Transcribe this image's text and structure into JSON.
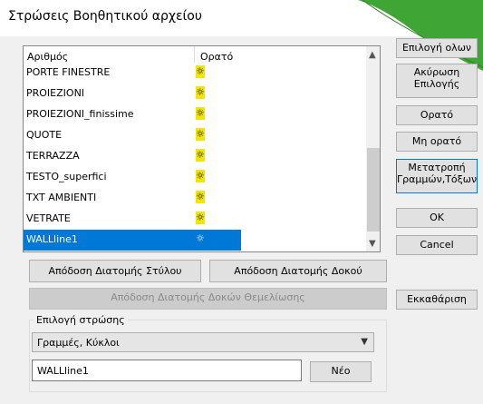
{
  "window": {
    "title": "Στρώσεις Βοηθητικού αρχείου",
    "close_glyph": "✕"
  },
  "list": {
    "col_number": "Αριθμός",
    "col_visible": "Ορατό",
    "rows": [
      {
        "name": "PORTE FINESTRE",
        "visible": "☼"
      },
      {
        "name": "PROIEZIONI",
        "visible": "☼"
      },
      {
        "name": "PROIEZIONI_finissime",
        "visible": "☼"
      },
      {
        "name": "QUOTE",
        "visible": "☼"
      },
      {
        "name": "TERRAZZA",
        "visible": "☼"
      },
      {
        "name": "TESTO_superfici",
        "visible": "☼"
      },
      {
        "name": "TXT AMBIENTI",
        "visible": "☼"
      },
      {
        "name": "VETRATE",
        "visible": "☼"
      },
      {
        "name": "WALLline1",
        "visible": "☼"
      }
    ],
    "selected_index": 8,
    "scroll_up": "▲",
    "scroll_down": "▼"
  },
  "side_buttons": {
    "select_all": "Επιλογή ολων",
    "cancel_selection_1": "Ακύρωση",
    "cancel_selection_2": "Επιλογής",
    "visible": "Ορατό",
    "invisible": "Μη ορατό",
    "convert_1": "Μετατροπή",
    "convert_2": "Γραμμών,Τόξων",
    "ok": "OK",
    "cancel": "Cancel"
  },
  "actions": {
    "assign_column": "Απόδοση Διατομής Στύλου",
    "assign_beam": "Απόδοση Διατομής Δοκού",
    "assign_foundation_beams": "Απόδοση Διατομής Δοκών Θεμελίωσης",
    "clear": "Εκκαθάριση"
  },
  "layer_select": {
    "label": "Επιλογή στρώσης",
    "combo_value": "Γραμμές, Κύκλοι",
    "combo_arrow": "▼",
    "input_value": "WALLline1",
    "new_button": "Νέο"
  },
  "colors": {
    "selection": "#0078d7",
    "accent_green": "#3fa535",
    "visible_icon": "#f2e600"
  }
}
